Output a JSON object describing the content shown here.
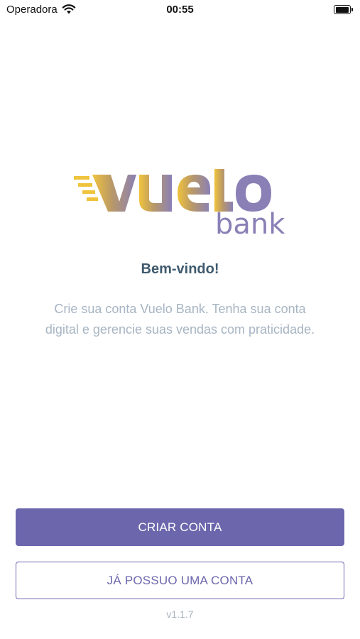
{
  "status_bar": {
    "carrier": "Operadora",
    "time": "00:55",
    "icons": [
      "wifi-icon",
      "battery-icon"
    ]
  },
  "logo": {
    "word": "Vuelo",
    "sub": "bank",
    "gradient_colors": [
      "#f0c33c",
      "#8a80b6"
    ]
  },
  "welcome": {
    "title": "Bem-vindo!",
    "line1": "Crie sua conta Vuelo Bank. Tenha sua conta",
    "line2": "digital e gerencie suas vendas com praticidade."
  },
  "buttons": {
    "create": "CRIAR CONTA",
    "login": "JÁ POSSUO UMA CONTA"
  },
  "version": "v1.1.7",
  "colors": {
    "primary": "#6c67ad",
    "title": "#3f5a6e",
    "subtitle": "#a7b5c3"
  }
}
